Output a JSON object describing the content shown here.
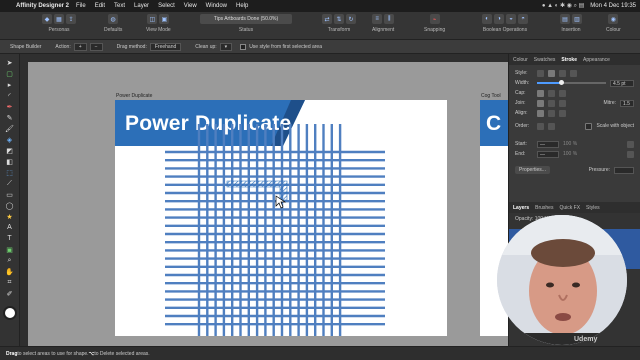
{
  "menubar": {
    "app_name": "Affinity Designer 2",
    "items": [
      "File",
      "Edit",
      "Text",
      "Layer",
      "Select",
      "View",
      "Window",
      "Help"
    ],
    "datetime": "Mon 4 Dec  19:35"
  },
  "toolbar": {
    "groups": [
      {
        "label": "Personas"
      },
      {
        "label": "Defaults"
      },
      {
        "label": "View Mode"
      },
      {
        "label": "Status"
      },
      {
        "label": "Transform"
      },
      {
        "label": "Alignment"
      },
      {
        "label": "Snapping"
      },
      {
        "label": "Boolean Operations"
      },
      {
        "label": "Insertion"
      },
      {
        "label": "Colour"
      }
    ],
    "document_name": "Tips Artboards Done (50.0%)"
  },
  "context": {
    "tool_name": "Shape Builder",
    "action_label": "Action:",
    "drag_method_label": "Drag method:",
    "drag_method_value": "Freehand",
    "cleanup_label": "Clean up:",
    "first_style_label": "Use style from first selected area"
  },
  "canvas": {
    "artboard1_label": "Power Duplicate",
    "artboard1_title": "Power Duplicate",
    "artboard2_label": "Cog Tool",
    "artboard2_title": "C",
    "banner_color": "#2c6fb8",
    "line_color": "#4f7fc0"
  },
  "panel": {
    "tabs": [
      "Colour",
      "Swatches",
      "Stroke",
      "Appearance"
    ],
    "active_tab": "Stroke",
    "style_label": "Style:",
    "width_label": "Width:",
    "width_value": "4.5 pt",
    "width_fraction": 0.35,
    "cap_label": "Cap:",
    "join_label": "Join:",
    "mitre_label": "Mitre:",
    "mitre_value": "1.5",
    "align_label": "Align:",
    "order_label": "Order:",
    "scale_label": "Scale with object",
    "start_label": "Start:",
    "end_label": "End:",
    "start_pct": "100 %",
    "end_pct": "100 %",
    "properties_button": "Properties...",
    "pressure_label": "Pressure:",
    "layer_tabs": [
      "Layers",
      "Brushes",
      "Quick FX",
      "Styles"
    ],
    "opacity_label": "Opacity: 100 %"
  },
  "status": {
    "text_bold1": "Drag",
    "text1": " to select areas to use for shape. ",
    "text_bold2": "⌥",
    "text2": " to Delete selected areas."
  },
  "watermark": "Udemy"
}
